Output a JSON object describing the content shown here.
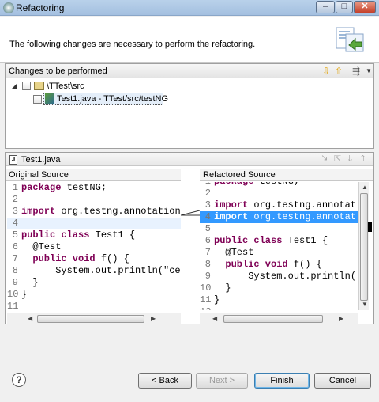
{
  "window": {
    "title": "Refactoring",
    "controls": {
      "minimize": "–",
      "maximize": "□",
      "close": "✕"
    }
  },
  "header": {
    "message": "The following changes are necessary to perform the refactoring."
  },
  "changes": {
    "title": "Changes to be performed",
    "tree": [
      {
        "label": "\\TTest\\src",
        "expanded": true,
        "checked": false
      },
      {
        "label": "Test1.java - TTest/src/testNG",
        "checked": false,
        "selected": true
      }
    ]
  },
  "compare": {
    "file": "Test1.java",
    "original": {
      "heading": "Original Source",
      "lines": [
        {
          "n": "1",
          "kw": "package",
          "rest": " testNG;"
        },
        {
          "n": "2",
          "kw": "",
          "rest": ""
        },
        {
          "n": "3",
          "kw": "import",
          "rest": " org.testng.annotation"
        },
        {
          "n": "4",
          "kw": "",
          "rest": ""
        },
        {
          "n": "5",
          "kw": "public class",
          "rest": " Test1 {"
        },
        {
          "n": "6",
          "kw": "",
          "rest": "  @Test"
        },
        {
          "n": "7",
          "kw": "  public void",
          "rest": " f() {"
        },
        {
          "n": "8",
          "kw": "",
          "rest": "      System.out.println(\"ce"
        },
        {
          "n": "9",
          "kw": "",
          "rest": "  }"
        },
        {
          "n": "10",
          "kw": "",
          "rest": "}"
        },
        {
          "n": "11",
          "kw": "",
          "rest": ""
        }
      ]
    },
    "refactored": {
      "heading": "Refactored Source",
      "lines": [
        {
          "n": "1",
          "kw": "package",
          "rest": " testNG;"
        },
        {
          "n": "2",
          "kw": "",
          "rest": ""
        },
        {
          "n": "3",
          "kw": "import",
          "rest": " org.testng.annotat"
        },
        {
          "n": "4",
          "kw": "import",
          "rest": " org.testng.annotat"
        },
        {
          "n": "5",
          "kw": "",
          "rest": ""
        },
        {
          "n": "6",
          "kw": "public class",
          "rest": " Test1 {"
        },
        {
          "n": "7",
          "kw": "",
          "rest": "  @Test"
        },
        {
          "n": "8",
          "kw": "  public void",
          "rest": " f() {"
        },
        {
          "n": "9",
          "kw": "",
          "rest": "      System.out.println("
        },
        {
          "n": "10",
          "kw": "",
          "rest": "  }"
        },
        {
          "n": "11",
          "kw": "",
          "rest": "}"
        },
        {
          "n": "12",
          "kw": "",
          "rest": ""
        }
      ]
    }
  },
  "buttons": {
    "help": "?",
    "back": "< Back",
    "next": "Next >",
    "finish": "Finish",
    "cancel": "Cancel"
  },
  "colors": {
    "keyword": "#7f0055",
    "selection": "#3399ff",
    "highlight_line": "#e8f2fe"
  }
}
